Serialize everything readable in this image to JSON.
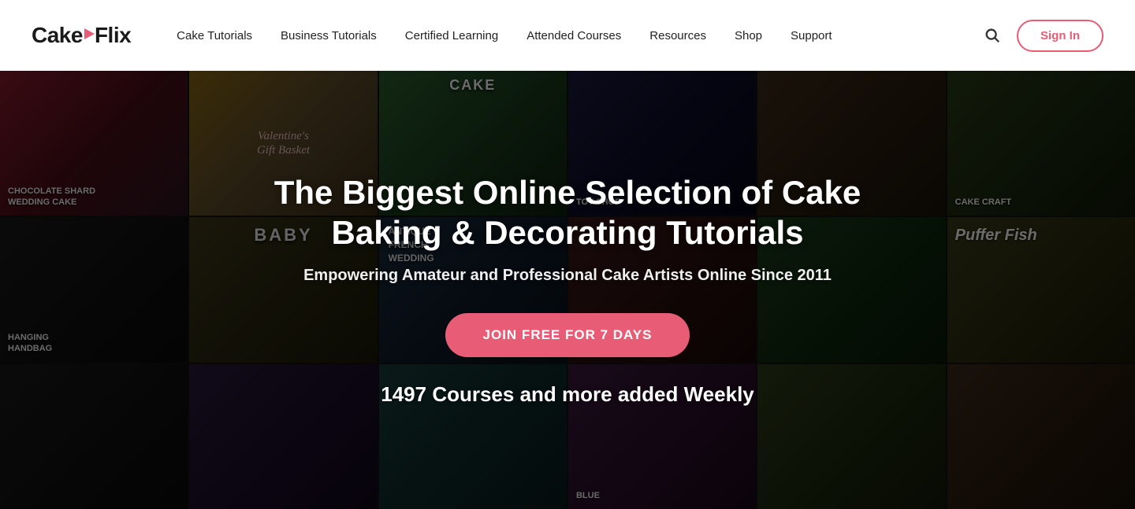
{
  "header": {
    "logo": {
      "text_part1": "Cake",
      "text_part2": "Flix"
    },
    "nav": {
      "items": [
        {
          "id": "cake-tutorials",
          "label": "Cake Tutorials"
        },
        {
          "id": "business-tutorials",
          "label": "Business Tutorials"
        },
        {
          "id": "certified-learning",
          "label": "Certified Learning"
        },
        {
          "id": "attended-courses",
          "label": "Attended Courses"
        },
        {
          "id": "resources",
          "label": "Resources"
        },
        {
          "id": "shop",
          "label": "Shop"
        },
        {
          "id": "support",
          "label": "Support"
        }
      ]
    },
    "signin_label": "Sign In"
  },
  "hero": {
    "title": "The Biggest Online Selection of Cake Baking & Decorating Tutorials",
    "subtitle": "Empowering Amateur and Professional Cake Artists Online Since 2011",
    "cta_label": "JOIN FREE FOR 7 DAYS",
    "count_text": "1497 Courses and more added Weekly",
    "cells": [
      {
        "id": "cell-1",
        "label": "CHOCOLATE SHARD\nWEDDING CAKE"
      },
      {
        "id": "cell-2",
        "label": "Valentine's\nGift Basket"
      },
      {
        "id": "cell-3",
        "label": "CAKE"
      },
      {
        "id": "cell-4",
        "label": "TOY SHOP"
      },
      {
        "id": "cell-5",
        "label": ""
      },
      {
        "id": "cell-6",
        "label": "CAKE CRAFT"
      },
      {
        "id": "cell-7",
        "label": "Hanging\nHandbag"
      },
      {
        "id": "cell-8",
        "label": "BABY"
      },
      {
        "id": "cell-9",
        "label": "ANTIQUE\nFRENCH\nWEDDING"
      },
      {
        "id": "cell-10",
        "label": ""
      },
      {
        "id": "cell-11",
        "label": ""
      },
      {
        "id": "cell-12",
        "label": "Puffer Fish"
      },
      {
        "id": "cell-13",
        "label": ""
      },
      {
        "id": "cell-14",
        "label": ""
      },
      {
        "id": "cell-15",
        "label": ""
      },
      {
        "id": "cell-16",
        "label": "Blue"
      },
      {
        "id": "cell-17",
        "label": ""
      },
      {
        "id": "cell-18",
        "label": ""
      }
    ]
  }
}
